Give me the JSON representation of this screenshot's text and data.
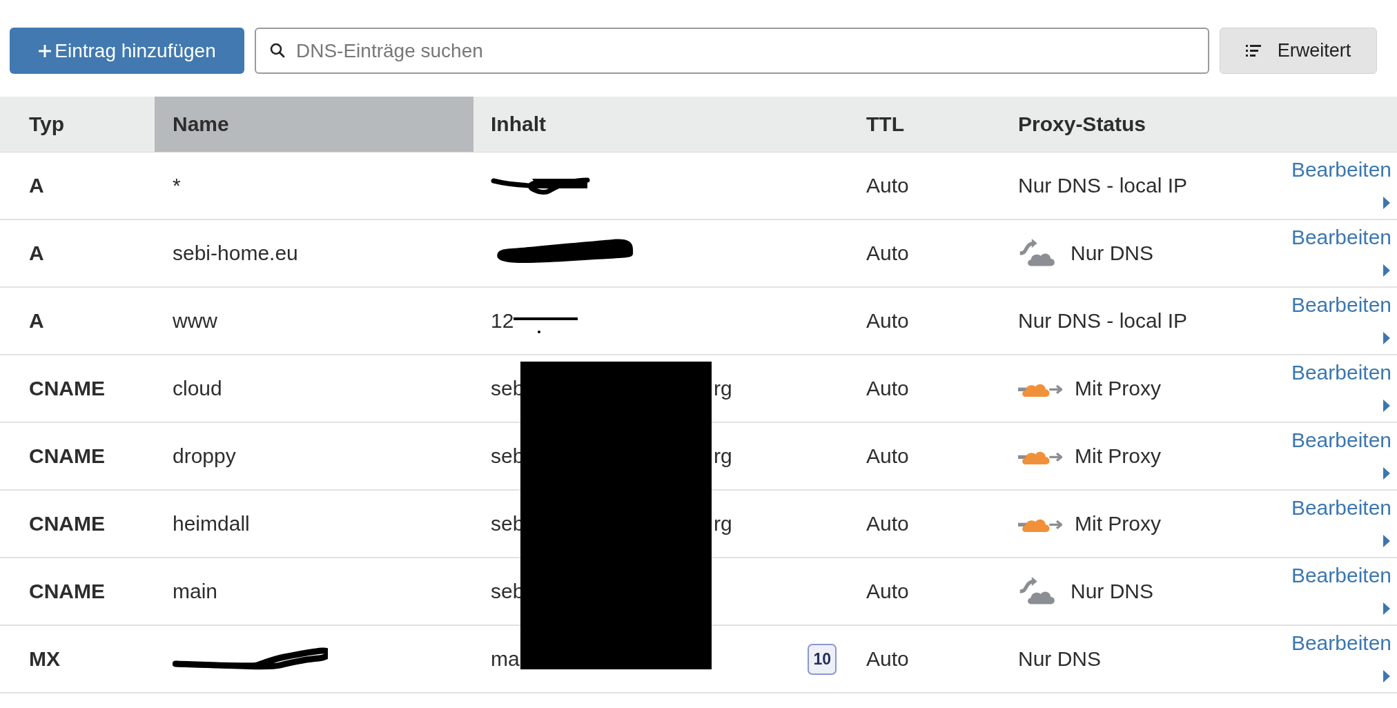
{
  "toolbar": {
    "add_button": "Eintrag hinzufügen",
    "search": {
      "placeholder": "DNS-Einträge suchen"
    },
    "advanced_button": "Erweitert"
  },
  "table": {
    "columns": [
      {
        "label": "Typ",
        "selected": false
      },
      {
        "label": "Name",
        "selected": true
      },
      {
        "label": "Inhalt",
        "selected": false
      },
      {
        "label": "TTL",
        "selected": false
      },
      {
        "label": "Proxy-Status",
        "selected": false
      }
    ],
    "rows": [
      {
        "type": "A",
        "name": "*",
        "content": {
          "kind": "scribbled"
        },
        "ttl": "Auto",
        "proxy": {
          "kind": "none",
          "label": "Nur DNS - local IP"
        },
        "action": "Bearbeiten"
      },
      {
        "type": "A",
        "name": "sebi-home.eu",
        "content": {
          "kind": "blotted"
        },
        "ttl": "Auto",
        "proxy": {
          "kind": "dns_only",
          "label": "Nur DNS"
        },
        "action": "Bearbeiten"
      },
      {
        "type": "A",
        "name": "www",
        "content": {
          "kind": "struck",
          "text": "12"
        },
        "ttl": "Auto",
        "proxy": {
          "kind": "none",
          "label": "Nur DNS - local IP"
        },
        "action": "Bearbeiten"
      },
      {
        "type": "CNAME",
        "name": "cloud",
        "content": {
          "kind": "covered",
          "start": "seb",
          "end": "rg"
        },
        "ttl": "Auto",
        "proxy": {
          "kind": "proxied",
          "label": "Mit Proxy"
        },
        "action": "Bearbeiten"
      },
      {
        "type": "CNAME",
        "name": "droppy",
        "content": {
          "kind": "covered",
          "start": "seb",
          "end": "rg"
        },
        "ttl": "Auto",
        "proxy": {
          "kind": "proxied",
          "label": "Mit Proxy"
        },
        "action": "Bearbeiten"
      },
      {
        "type": "CNAME",
        "name": "heimdall",
        "content": {
          "kind": "covered",
          "start": "seb",
          "end": "rg"
        },
        "ttl": "Auto",
        "proxy": {
          "kind": "proxied",
          "label": "Mit Proxy"
        },
        "action": "Bearbeiten"
      },
      {
        "type": "CNAME",
        "name": "main",
        "content": {
          "kind": "covered",
          "start": "seb"
        },
        "ttl": "Auto",
        "proxy": {
          "kind": "dns_only",
          "label": "Nur DNS"
        },
        "action": "Bearbeiten"
      },
      {
        "type": "MX",
        "name_hidden": true,
        "content": {
          "kind": "covered",
          "start": "ma",
          "priority": "10"
        },
        "ttl": "Auto",
        "proxy": {
          "kind": "none",
          "label": "Nur DNS"
        },
        "action": "Bearbeiten"
      }
    ]
  }
}
